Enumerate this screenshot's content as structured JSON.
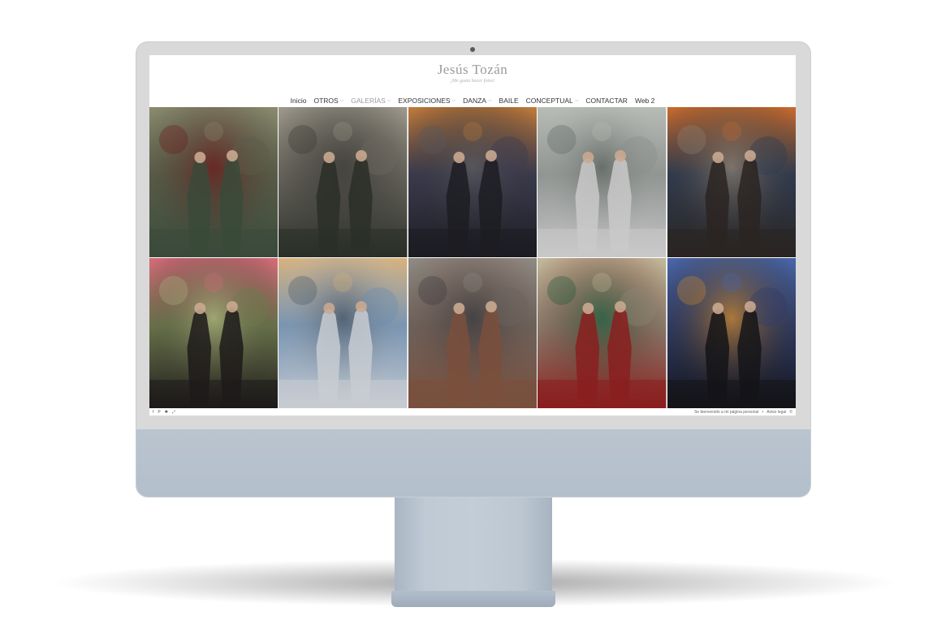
{
  "site": {
    "title": "Jesús Tozán",
    "tagline": "¡Me gusta hacer fotos!"
  },
  "nav": {
    "items": [
      {
        "label": "Inicio",
        "has_dropdown": false
      },
      {
        "label": "OTROS",
        "has_dropdown": true
      },
      {
        "label": "GALERÍAS",
        "has_dropdown": true,
        "active": true
      },
      {
        "label": "EXPOSICIONES",
        "has_dropdown": true
      },
      {
        "label": "DANZA",
        "has_dropdown": true
      },
      {
        "label": "BAILE",
        "has_dropdown": false
      },
      {
        "label": "CONCEPTUAL",
        "has_dropdown": true
      },
      {
        "label": "CONTACTAR",
        "has_dropdown": false
      },
      {
        "label": "Web 2",
        "has_dropdown": false
      }
    ],
    "dropdown_icon": "chevron-down-icon"
  },
  "gallery": {
    "tiles": [
      {
        "name": "eye-bleeding-two-women-table",
        "colors": [
          "#5b5f4a",
          "#8b8a6e",
          "#6a1b1b",
          "#3a4a3a"
        ]
      },
      {
        "name": "giant-eye-wall-two-women",
        "colors": [
          "#6e6a62",
          "#9d978b",
          "#3c3a35",
          "#2a2f28"
        ]
      },
      {
        "name": "sunset-stone-face-two-women",
        "colors": [
          "#3d3d52",
          "#c07a3a",
          "#5a5a5e",
          "#1c1c22"
        ]
      },
      {
        "name": "ornate-wall-two-gowns",
        "colors": [
          "#8a8f8c",
          "#b8bcb6",
          "#5f6660",
          "#c9c9c9"
        ]
      },
      {
        "name": "sunset-sky-two-women-studio",
        "colors": [
          "#2e3b52",
          "#c76a2d",
          "#8d8072",
          "#2a2522"
        ]
      },
      {
        "name": "pink-portal-two-women",
        "colors": [
          "#6f7a4e",
          "#d46a78",
          "#a8b07a",
          "#1d1a1a"
        ]
      },
      {
        "name": "painter-canvas-sky",
        "colors": [
          "#6f8fb0",
          "#d8b27c",
          "#4a5866",
          "#c8ccd2"
        ]
      },
      {
        "name": "clock-painter-two-women",
        "colors": [
          "#6c6560",
          "#8e8a84",
          "#3b3a3e",
          "#7a4f3c"
        ]
      },
      {
        "name": "skull-two-gowns",
        "colors": [
          "#8a8674",
          "#c2b99a",
          "#1e5a3c",
          "#8a1e1e"
        ]
      },
      {
        "name": "blue-skull-fire-two-women",
        "colors": [
          "#2f3d6a",
          "#4a66a8",
          "#c9862e",
          "#141418"
        ]
      }
    ]
  },
  "footer": {
    "social_icons": [
      "facebook-icon",
      "pinterest-icon",
      "star-icon",
      "share-icon"
    ],
    "text": "Se bienvenido a mi página personal",
    "separator": "•",
    "link": "Aviso legal"
  }
}
